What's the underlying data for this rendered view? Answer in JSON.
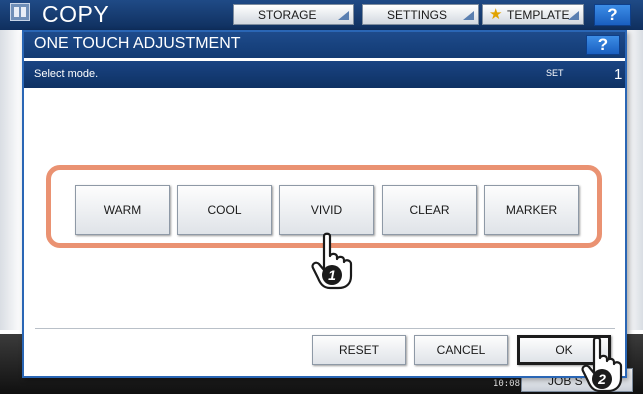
{
  "background": {
    "app_title": "COPY",
    "header_buttons": [
      {
        "label": "STORAGE"
      },
      {
        "label": "SETTINGS"
      },
      {
        "label": "TEMPLATE",
        "icon": "star-icon"
      }
    ],
    "help_label": "?",
    "time": "10:08",
    "jobs_button": "JOB S"
  },
  "dialog": {
    "title": "ONE TOUCH ADJUSTMENT",
    "help_label": "?",
    "instruction": "Select mode.",
    "set_label": "SET",
    "set_value": "1",
    "modes": [
      {
        "label": "WARM"
      },
      {
        "label": "COOL"
      },
      {
        "label": "VIVID"
      },
      {
        "label": "CLEAR"
      },
      {
        "label": "MARKER"
      }
    ],
    "actions": {
      "reset": "RESET",
      "cancel": "CANCEL",
      "ok": "OK"
    }
  },
  "callouts": [
    {
      "step": "1",
      "icon": "pointing-hand-icon"
    },
    {
      "step": "2",
      "icon": "pointing-hand-icon"
    }
  ],
  "colors": {
    "header_blue": "#1f4a86",
    "highlight_frame": "#ea9272",
    "help_blue": "#1a5fc0"
  }
}
